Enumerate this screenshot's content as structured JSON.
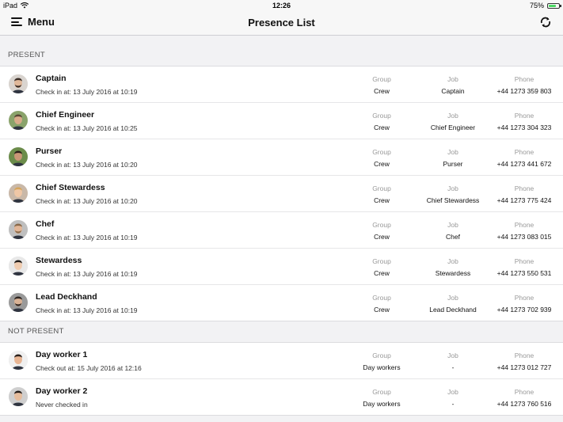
{
  "status_bar": {
    "device": "iPad",
    "time": "12:26",
    "battery": "75%",
    "battery_level": 0.75
  },
  "nav": {
    "menu_label": "Menu",
    "title": "Presence List"
  },
  "columns": {
    "group": "Group",
    "job": "Job",
    "phone": "Phone"
  },
  "present": {
    "header": "PRESENT",
    "rows": [
      {
        "name": "Captain",
        "sub": "Check in at: 13 July 2016 at 10:19",
        "group": "Crew",
        "job": "Captain",
        "phone": "+44 1273 359 803"
      },
      {
        "name": "Chief Engineer",
        "sub": "Check in at: 13 July 2016 at 10:25",
        "group": "Crew",
        "job": "Chief Engineer",
        "phone": "+44 1273 304 323"
      },
      {
        "name": "Purser",
        "sub": "Check in at: 13 July 2016 at 10:20",
        "group": "Crew",
        "job": "Purser",
        "phone": "+44 1273 441 672"
      },
      {
        "name": "Chief Stewardess",
        "sub": "Check in at: 13 July 2016 at 10:20",
        "group": "Crew",
        "job": "Chief Stewardess",
        "phone": "+44 1273 775 424"
      },
      {
        "name": "Chef",
        "sub": "Check in at: 13 July 2016 at 10:19",
        "group": "Crew",
        "job": "Chef",
        "phone": "+44 1273 083 015"
      },
      {
        "name": "Stewardess",
        "sub": "Check in at: 13 July 2016 at 10:19",
        "group": "Crew",
        "job": "Stewardess",
        "phone": "+44 1273 550 531"
      },
      {
        "name": "Lead Deckhand",
        "sub": "Check in at: 13 July 2016 at 10:19",
        "group": "Crew",
        "job": "Lead Deckhand",
        "phone": "+44 1273 702 939"
      }
    ]
  },
  "not_present": {
    "header": "NOT PRESENT",
    "rows": [
      {
        "name": "Day worker 1",
        "sub": "Check out at: 15 July 2016 at 12:16",
        "group": "Day workers",
        "job": "-",
        "phone": "+44 1273 012 727"
      },
      {
        "name": "Day worker 2",
        "sub": "Never checked in",
        "group": "Day workers",
        "job": "-",
        "phone": "+44 1273 760 516"
      }
    ]
  },
  "icons": {
    "menu": "hamburger-icon",
    "refresh": "refresh-icon",
    "wifi": "wifi-icon",
    "battery": "battery-icon",
    "avatar": "person-avatar"
  },
  "colors": {
    "background": "#f2f2f4",
    "row": "#ffffff",
    "label": "#999999",
    "battery": "#4cd964"
  }
}
